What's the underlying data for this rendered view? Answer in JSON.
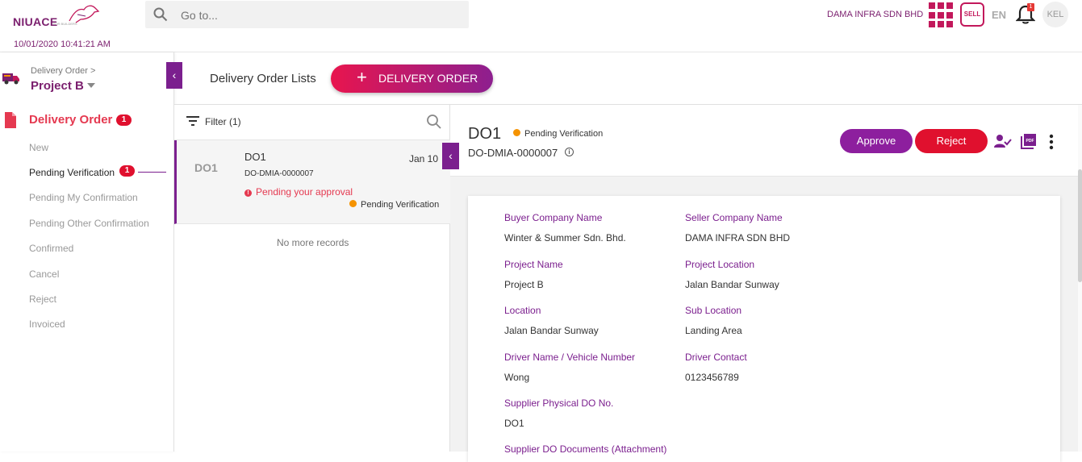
{
  "app": {
    "logo_text": "niuace",
    "logo_sub": "FOR BUILDERS",
    "search_placeholder": "Go to...",
    "company": "DAMA INFRA SDN BHD",
    "sell_label": "SELL",
    "language": "EN",
    "notification_count": "1",
    "user_initials": "KEL",
    "datetime": "10/01/2020 10:41:21 AM",
    "accent_color": "#7b1f8e",
    "danger_color": "#e0102e"
  },
  "sidebar": {
    "breadcrumb": "Delivery Order >",
    "project": "Project B",
    "section_title": "Delivery Order",
    "section_badge": "1",
    "items": [
      {
        "label": "New"
      },
      {
        "label": "Pending Verification",
        "badge": "1",
        "active": true
      },
      {
        "label": "Pending My Confirmation"
      },
      {
        "label": "Pending Other Confirmation"
      },
      {
        "label": "Confirmed"
      },
      {
        "label": "Cancel"
      },
      {
        "label": "Reject"
      },
      {
        "label": "Invoiced"
      }
    ]
  },
  "header": {
    "title": "Delivery Order Lists",
    "add_button": "DELIVERY ORDER"
  },
  "list": {
    "filter_label": "Filter (1)",
    "rows": [
      {
        "code": "DO1",
        "title": "DO1",
        "number": "DO-DMIA-0000007",
        "warning": "Pending your approval",
        "date": "Jan 10",
        "status": "Pending Verification"
      }
    ],
    "end_text": "No more records"
  },
  "detail": {
    "title": "DO1",
    "status": "Pending Verification",
    "number": "DO-DMIA-0000007",
    "approve_label": "Approve",
    "reject_label": "Reject",
    "pdf_label": "PDF",
    "fields": {
      "buyer_company_label": "Buyer Company Name",
      "buyer_company_value": "Winter & Summer Sdn. Bhd.",
      "seller_company_label": "Seller Company Name",
      "seller_company_value": "DAMA INFRA SDN BHD",
      "project_name_label": "Project Name",
      "project_name_value": "Project B",
      "project_location_label": "Project Location",
      "project_location_value": "Jalan Bandar Sunway",
      "location_label": "Location",
      "location_value": "Jalan Bandar Sunway",
      "sub_location_label": "Sub Location",
      "sub_location_value": "Landing Area",
      "driver_label": "Driver Name / Vehicle Number",
      "driver_value": "Wong",
      "driver_contact_label": "Driver Contact",
      "driver_contact_value": "0123456789",
      "supplier_do_label": "Supplier Physical DO No.",
      "supplier_do_value": "DO1",
      "supplier_docs_label": "Supplier DO Documents (Attachment)"
    }
  }
}
